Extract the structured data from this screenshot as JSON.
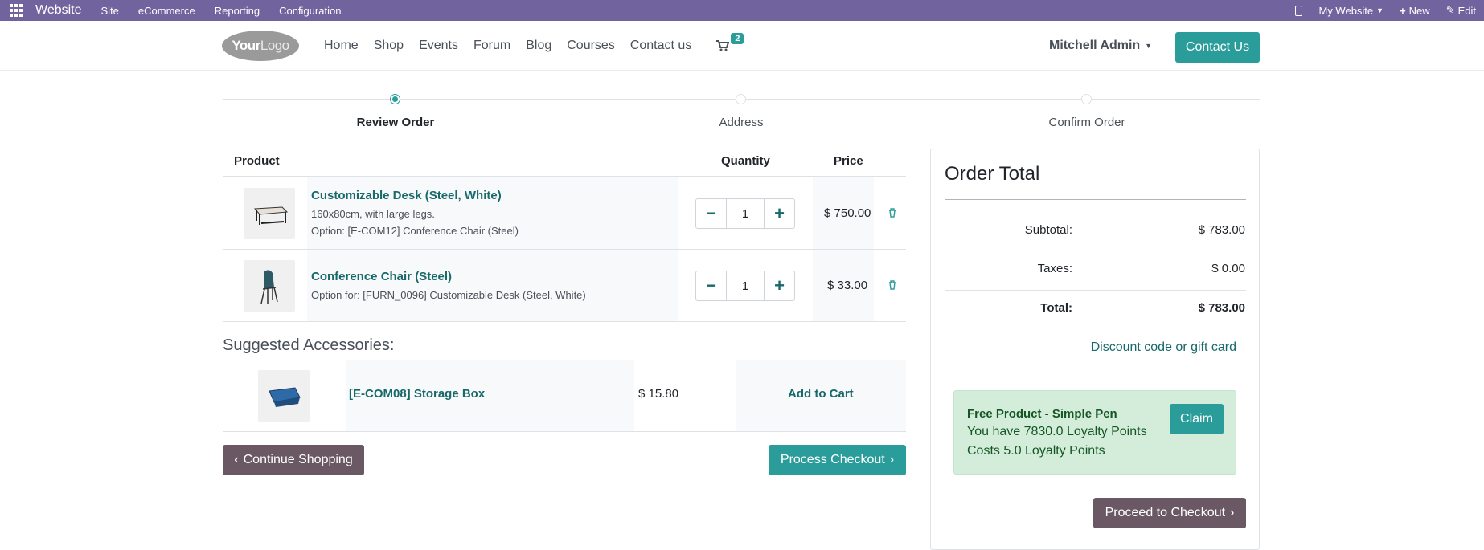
{
  "adminbar": {
    "brand": "Website",
    "menus": [
      "Site",
      "eCommerce",
      "Reporting",
      "Configuration"
    ],
    "my_website": "My Website",
    "new": "New",
    "edit": "Edit"
  },
  "header": {
    "logo_a": "Your",
    "logo_b": "Logo",
    "nav": [
      "Home",
      "Shop",
      "Events",
      "Forum",
      "Blog",
      "Courses",
      "Contact us"
    ],
    "cart_count": "2",
    "user": "Mitchell Admin",
    "contact_button": "Contact Us"
  },
  "steps": [
    "Review Order",
    "Address",
    "Confirm Order"
  ],
  "table": {
    "headers": {
      "product": "Product",
      "quantity": "Quantity",
      "price": "Price"
    },
    "rows": [
      {
        "name": "Customizable Desk (Steel, White)",
        "desc1": "160x80cm, with large legs.",
        "desc2": "Option: [E-COM12] Conference Chair (Steel)",
        "qty": "1",
        "price": "$ 750.00"
      },
      {
        "name": "Conference Chair (Steel)",
        "desc1": "Option for: [FURN_0096] Customizable Desk (Steel, White)",
        "qty": "1",
        "price": "$ 33.00"
      }
    ]
  },
  "suggested": {
    "title": "Suggested Accessories:",
    "item": {
      "name": "[E-COM08] Storage Box",
      "price": "$ 15.80",
      "action": "Add to Cart"
    }
  },
  "buttons": {
    "continue": "Continue Shopping",
    "process": "Process Checkout"
  },
  "summary": {
    "title": "Order Total",
    "subtotal_label": "Subtotal:",
    "subtotal": "$ 783.00",
    "taxes_label": "Taxes:",
    "taxes": "$ 0.00",
    "total_label": "Total:",
    "total": "$ 783.00",
    "discount_link": "Discount code or gift card",
    "promo": {
      "title": "Free Product - Simple Pen",
      "line1": "You have 7830.0 Loyalty Points",
      "line2": "Costs 5.0 Loyalty Points",
      "claim": "Claim"
    },
    "proceed": "Proceed to Checkout"
  }
}
